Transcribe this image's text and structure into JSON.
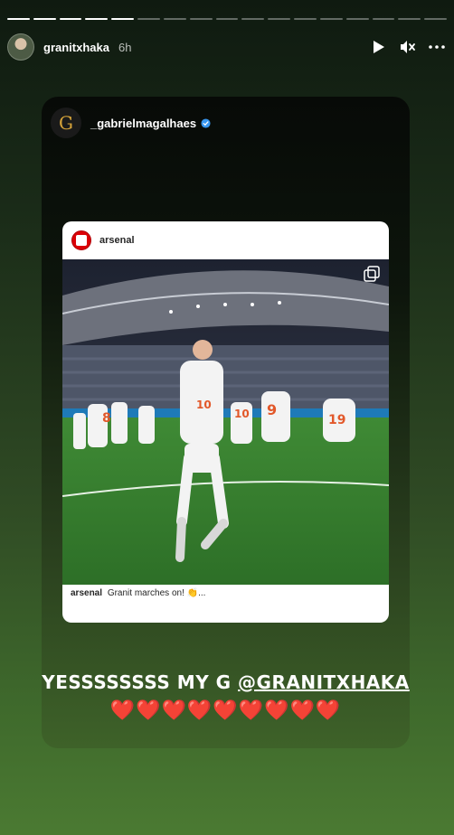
{
  "story": {
    "progress": {
      "segments_total": 17,
      "segments_complete": 5
    },
    "author": {
      "username": "granitxhaka",
      "time": "6h"
    },
    "controls": {
      "play_icon": "play-icon",
      "mute_icon": "mute-icon",
      "more_icon": "more-icon"
    }
  },
  "shared_post": {
    "source_account": "_gabrielmagalhaes",
    "source_logo_letter": "G",
    "verified_icon": "verified-badge-icon",
    "embedded_post": {
      "account": "arsenal",
      "caption_account": "arsenal",
      "caption_text": "Granit marches on! 👏...",
      "multi_image_icon": "carousel-icon",
      "player_numbers": [
        "10",
        "8",
        "10",
        "9",
        "19"
      ]
    },
    "sticker_text": "YESSSSSSSS MY G",
    "sticker_mention": "@GRANITXHAKA",
    "hearts": "❤️❤️❤️❤️❤️❤️❤️❤️❤️"
  },
  "colors": {
    "arsenal_red": "#db0007",
    "verified_blue": "#3897f0",
    "heart_red": "#e4232a"
  }
}
